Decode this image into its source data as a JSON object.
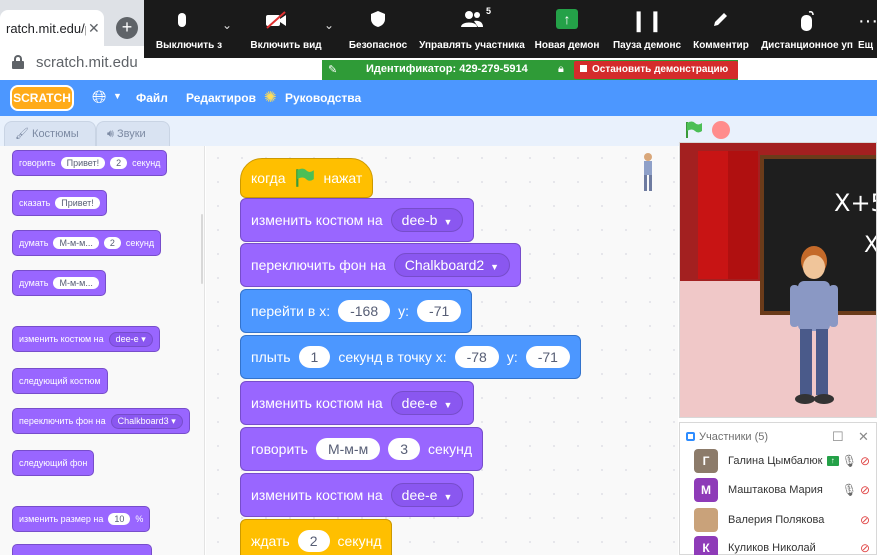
{
  "browser": {
    "tab_title": "ratch.mit.edu/p",
    "tab_close": "✕",
    "new_tab": "+",
    "url": "scratch.mit.edu"
  },
  "zoom": {
    "buttons": [
      {
        "label": "Выключить з",
        "icon": "microphone-icon"
      },
      {
        "label": "Включить вид",
        "icon": "video-off-icon"
      },
      {
        "label": "Безопаснос",
        "icon": "shield-icon"
      },
      {
        "label": "Управлять участника",
        "icon": "participants-icon",
        "count": "5"
      },
      {
        "label": "Новая демон",
        "icon": "share-screen-icon"
      },
      {
        "label": "Пауза демонс",
        "icon": "pause-icon"
      },
      {
        "label": "Комментир",
        "icon": "pen-icon"
      },
      {
        "label": "Дистанционное уп",
        "icon": "remote-control-icon"
      },
      {
        "label": "Ещ",
        "icon": "more-icon"
      }
    ],
    "share_id": "Идентификатор: 429-279-5914",
    "stop_share": "Остановить демонстрацию",
    "accent_green": "#2f9b37",
    "stop_red": "#d42b2b"
  },
  "menubar": {
    "logo": "SCRATCH",
    "file": "Файл",
    "edit": "Редактиров",
    "tutorials": "Руководства",
    "accent": "#4c97ff"
  },
  "tabs": {
    "costumes": "Костюмы",
    "sounds": "Звуки"
  },
  "palette": {
    "say_timed": {
      "text": "говорить",
      "msg": "Привет!",
      "secs": "2",
      "unit": "секунд"
    },
    "say": {
      "text": "сказать",
      "msg": "Привет!"
    },
    "think_timed": {
      "text": "думать",
      "msg": "М-м-м...",
      "secs": "2",
      "unit": "секунд"
    },
    "think": {
      "text": "думать",
      "msg": "М-м-м..."
    },
    "switch_costume": {
      "text": "изменить костюм на",
      "value": "dee-e"
    },
    "next_costume": "следующий костюм",
    "switch_backdrop": {
      "text": "переключить фон на",
      "value": "Chalkboard3"
    },
    "next_backdrop": "следующий фон",
    "change_size": {
      "text": "изменить размер на",
      "value": "10",
      "unit": "%"
    }
  },
  "script": {
    "when": "когда",
    "clicked": "нажат",
    "costume1": {
      "text": "изменить костюм на",
      "value": "dee-b"
    },
    "backdrop": {
      "text": "переключить фон на",
      "value": "Chalkboard2"
    },
    "goto": {
      "text": "перейти в x:",
      "x": "-168",
      "ylabel": "y:",
      "y": "-71"
    },
    "glide": {
      "text": "плыть",
      "secs": "1",
      "text2": "секунд в точку x:",
      "x": "-78",
      "ylabel": "y:",
      "y": "-71"
    },
    "costume2": {
      "text": "изменить костюм на",
      "value": "dee-e"
    },
    "say": {
      "text": "говорить",
      "msg": "М-м-м",
      "secs": "3",
      "unit": "секунд"
    },
    "costume3": {
      "text": "изменить костюм на",
      "value": "dee-e"
    },
    "wait": {
      "text": "ждать",
      "secs": "2",
      "unit": "секунд"
    }
  },
  "stage": {
    "board_line1": "X+5",
    "board_line2": "X="
  },
  "participants": {
    "title": "Участники (5)",
    "list": [
      {
        "initial": "Г",
        "name": "Галина Цымбалюк",
        "color": "#8c7b6a"
      },
      {
        "initial": "М",
        "name": "Маштакова Мария",
        "color": "#8e3bb8"
      },
      {
        "initial": "",
        "name": "Валерия Полякова",
        "color": "#c9a27a"
      },
      {
        "initial": "К",
        "name": "Куликов Николай",
        "color": "#8e3bb8"
      }
    ]
  }
}
